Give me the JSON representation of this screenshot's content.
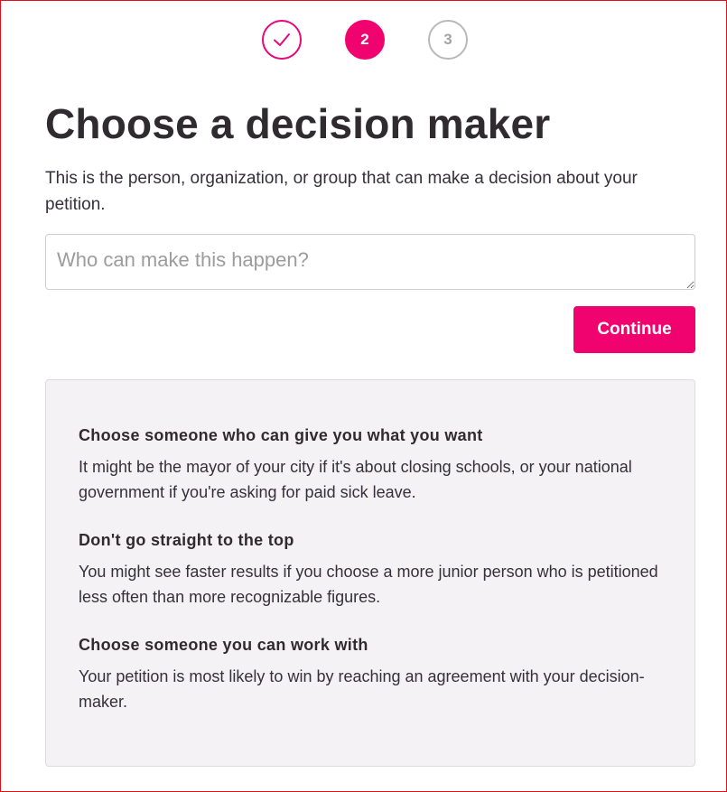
{
  "stepper": {
    "steps": [
      {
        "label": "",
        "state": "completed",
        "icon": "checkmark-icon"
      },
      {
        "label": "2",
        "state": "current"
      },
      {
        "label": "3",
        "state": "upcoming"
      }
    ],
    "colors": {
      "accent": "#f0036f",
      "inactive": "#b9b9b9"
    }
  },
  "header": {
    "title": "Choose a decision maker",
    "subtitle": "This is the person, organization, or group that can make a decision about your petition."
  },
  "decision_maker_input": {
    "value": "",
    "placeholder": "Who can make this happen?"
  },
  "actions": {
    "continue_label": "Continue"
  },
  "tips": [
    {
      "heading": "Choose someone who can give you what you want",
      "body": "It might be the mayor of your city if it's about closing schools, or your national government if you're asking for paid sick leave."
    },
    {
      "heading": "Don't go straight to the top",
      "body": "You might see faster results if you choose a more junior person who is petitioned less often than more recognizable figures."
    },
    {
      "heading": "Choose someone you can work with",
      "body": "Your petition is most likely to win by reaching an agreement with your decision-maker."
    }
  ]
}
